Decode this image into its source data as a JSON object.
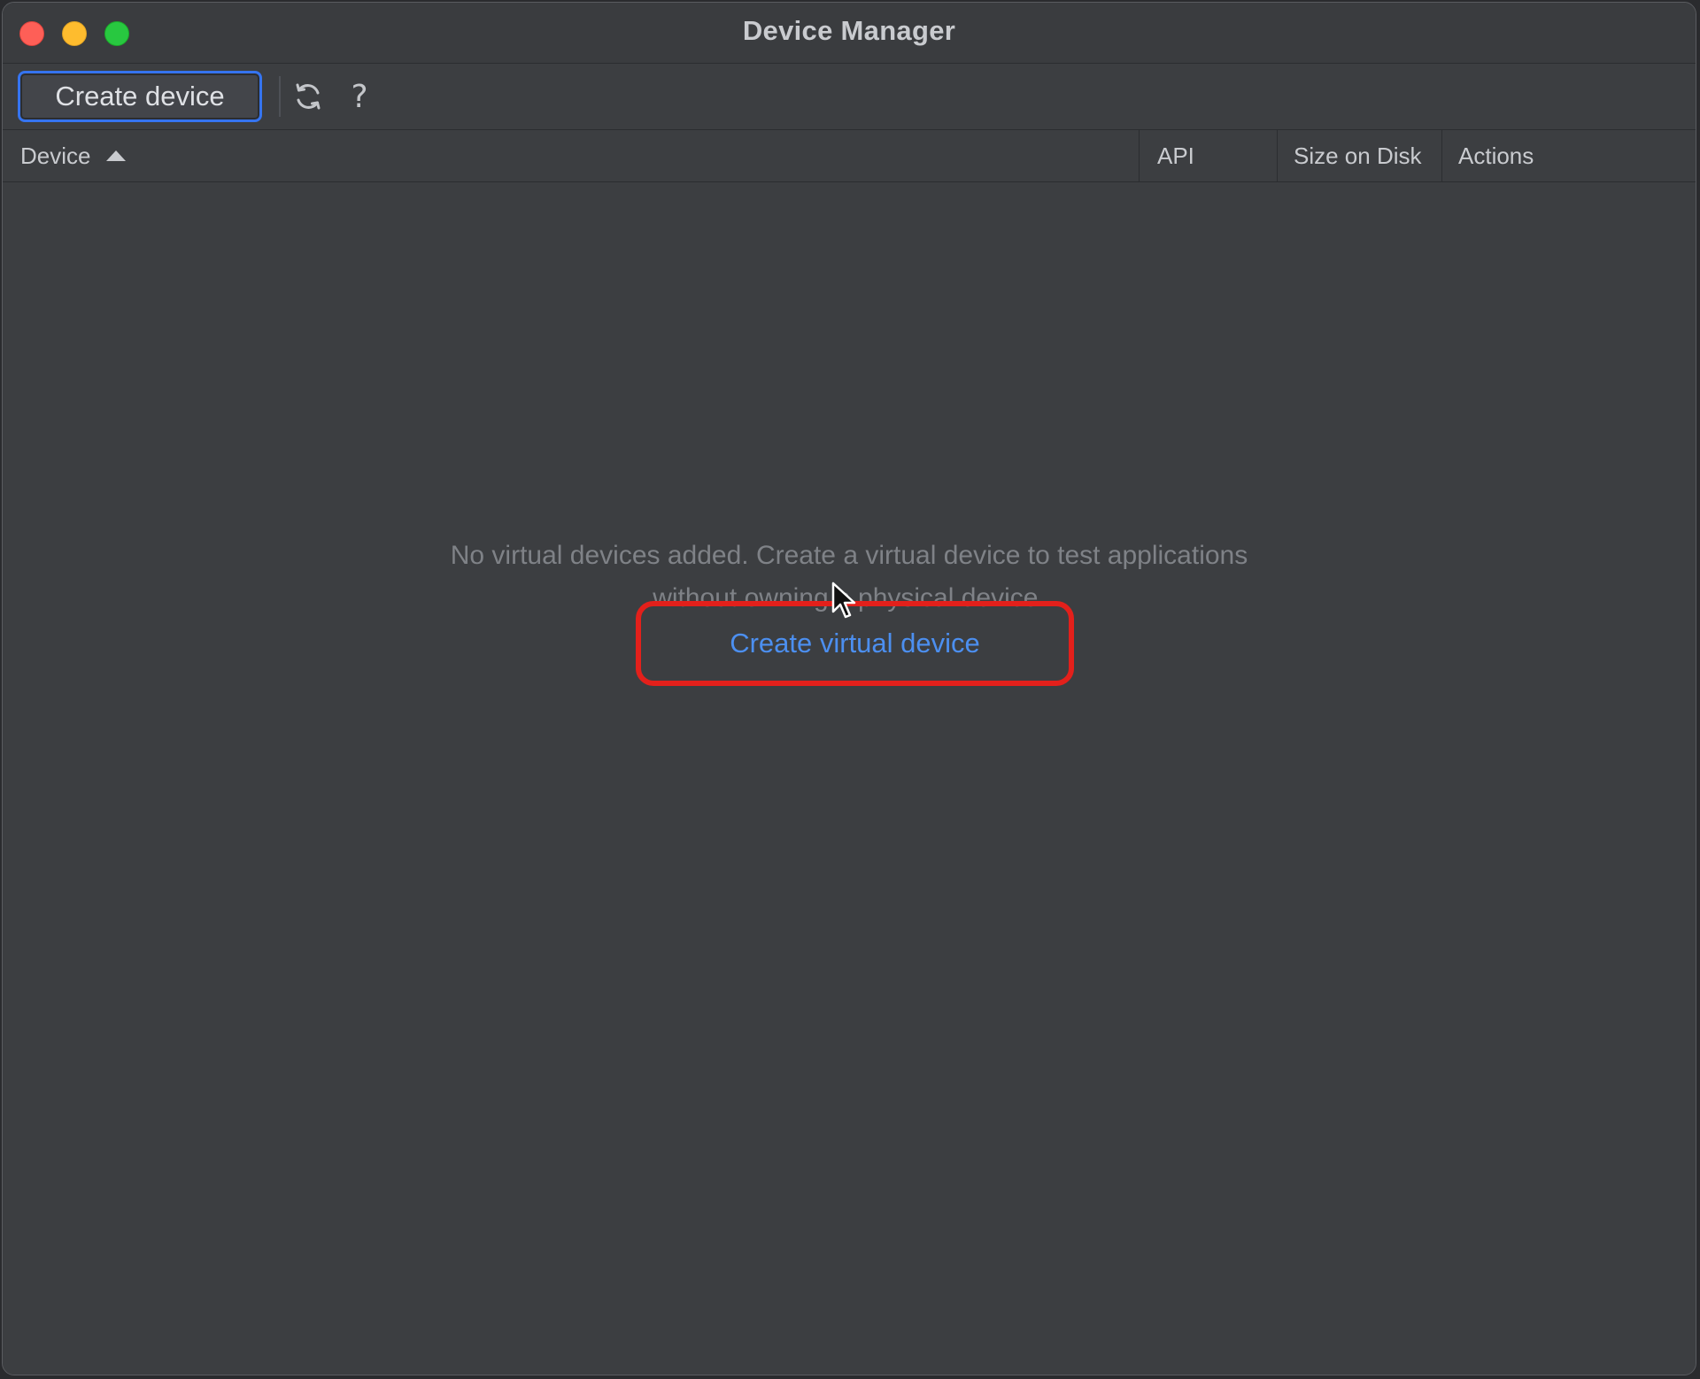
{
  "window": {
    "title": "Device Manager"
  },
  "toolbar": {
    "create_label": "Create device",
    "refresh_icon": "refresh-icon",
    "help_label": "?"
  },
  "table": {
    "columns": [
      "Device",
      "API",
      "Size on Disk",
      "Actions"
    ],
    "sort": {
      "column": "Device",
      "direction": "ascending"
    }
  },
  "empty_state": {
    "message": "No virtual devices added. Create a virtual device to test applications without owning a physical device.",
    "link_label": "Create virtual device",
    "highlight_color": "#e3201b"
  },
  "colors": {
    "accent": "#3574f0",
    "link": "#4c8ff0",
    "background": "#3c3e41"
  }
}
